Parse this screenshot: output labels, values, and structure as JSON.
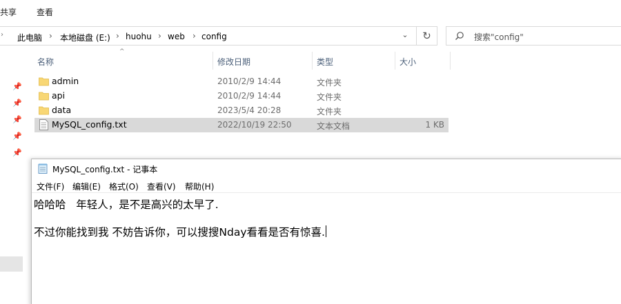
{
  "ribbon": {
    "tabs": [
      "共享",
      "查看"
    ]
  },
  "address": {
    "crumbs": [
      "此电脑",
      "本地磁盘 (E:)",
      "huohu",
      "web",
      "config"
    ],
    "search_placeholder": "搜索\"config\""
  },
  "columns": {
    "name": "名称",
    "date": "修改日期",
    "type": "类型",
    "size": "大小"
  },
  "files": [
    {
      "name": "admin",
      "date": "2010/2/9 14:44",
      "type": "文件夹",
      "size": "",
      "icon": "folder-icon"
    },
    {
      "name": "api",
      "date": "2010/2/9 14:44",
      "type": "文件夹",
      "size": "",
      "icon": "folder-icon"
    },
    {
      "name": "data",
      "date": "2023/5/4 20:28",
      "type": "文件夹",
      "size": "",
      "icon": "folder-icon"
    },
    {
      "name": "MySQL_config.txt",
      "date": "2022/10/19 22:50",
      "type": "文本文档",
      "size": "1 KB",
      "icon": "text-file-icon",
      "selected": true
    }
  ],
  "notepad": {
    "title": "MySQL_config.txt - 记事本",
    "menu": [
      "文件(F)",
      "编辑(E)",
      "格式(O)",
      "查看(V)",
      "帮助(H)"
    ],
    "lines": [
      "哈哈哈   年轻人，是不是高兴的太早了.",
      "",
      "不过你能找到我 不妨告诉你，可以搜搜Nday看看是否有惊喜."
    ]
  },
  "colors": {
    "selected_row": "#d9d9d9",
    "folder": "#f8d775",
    "header_text": "#4c607a"
  }
}
